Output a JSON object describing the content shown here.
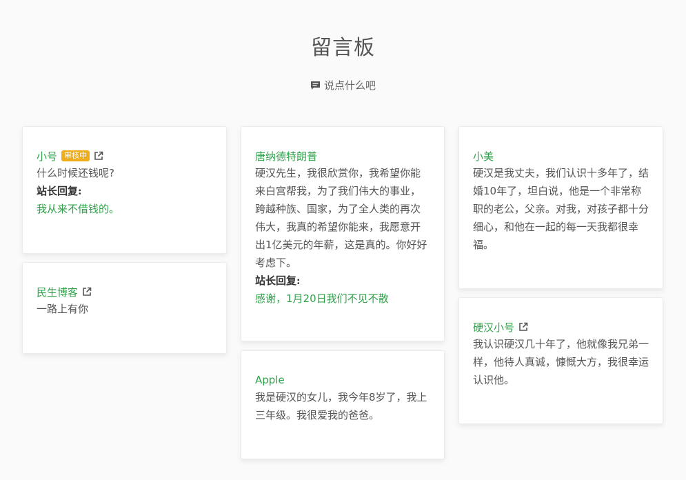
{
  "board": {
    "title": "留言板",
    "compose_label": "说点什么吧"
  },
  "messages": [
    {
      "author": "小号",
      "badge": "审核中",
      "content": "什么时候还钱呢?",
      "reply_label": "站长回复:",
      "reply": "我从来不借钱的。"
    },
    {
      "author": "民生博客",
      "content": "一路上有你"
    },
    {
      "author": "唐纳德特朗普",
      "content": "硬汉先生，我很欣赏你，我希望你能来白宫帮我，为了我们伟大的事业，跨越种族、国家，为了全人类的再次伟大，我真的希望你能来，我愿意开出1亿美元的年薪，这是真的。你好好考虑下。",
      "reply_label": "站长回复:",
      "reply": "感谢，1月20日我们不见不散"
    },
    {
      "author": "Apple",
      "content": "我是硬汉的女儿，我今年8岁了，我上三年级。我很爱我的爸爸。"
    },
    {
      "author": "小美",
      "content": "硬汉是我丈夫，我们认识十多年了，结婚10年了，坦白说，他是一个非常称职的老公，父亲。对我，对孩子都十分细心，和他在一起的每一天我都很幸福。"
    },
    {
      "author": "硬汉小号",
      "content": "我认识硬汉几十年了，他就像我兄弟一样，他待人真诚，慷慨大方，我很幸运认识他。"
    }
  ],
  "colors": {
    "author_link": "#2fa24a",
    "badge": "#f0ad1a",
    "reply_text": "#2fa24a"
  },
  "icons": {
    "compose": "comment-icon",
    "author_link": "external-link-icon"
  }
}
